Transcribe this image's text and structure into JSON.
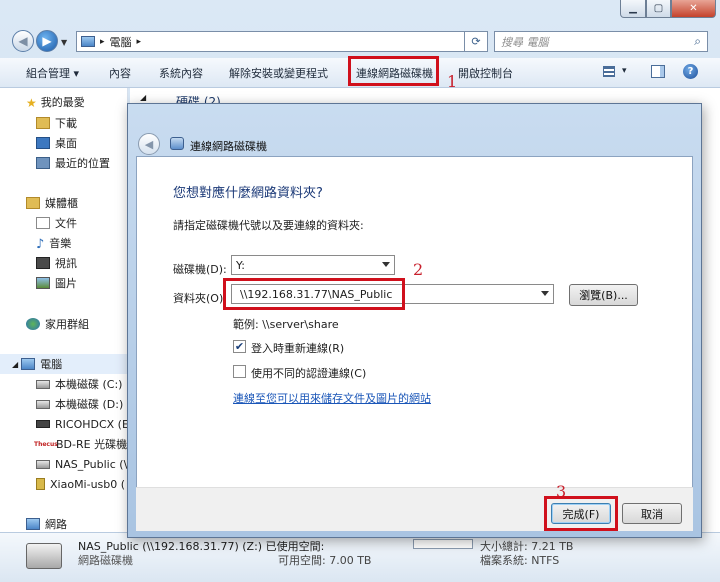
{
  "address": {
    "path": "電腦",
    "search_placeholder": "搜尋 電腦"
  },
  "toolbar": {
    "organize": "組合管理 ▾",
    "properties": "內容",
    "system_properties": "系統內容",
    "uninstall": "解除安裝或變更程式",
    "map_drive": "連線網路磁碟機",
    "control_panel": "開啟控制台",
    "view_arrow": "▾"
  },
  "annotations": {
    "n1": "1",
    "n2": "2",
    "n3": "3"
  },
  "navpane": {
    "favorites": "我的最愛",
    "fav_items": [
      "下載",
      "桌面",
      "最近的位置"
    ],
    "libraries": "媒體櫃",
    "lib_items": [
      "文件",
      "音樂",
      "視訊",
      "圖片"
    ],
    "homegroup": "家用群組",
    "computer": "電腦",
    "computer_items": [
      "本機磁碟 (C:)",
      "本機磁碟 (D:)",
      "RICOHDCX (E:",
      "BD-RE 光碟機 (",
      "NAS_Public (\\\\",
      "XiaoMi-usb0 (",
      "網路"
    ],
    "brand_label": "Thecus"
  },
  "content": {
    "group_header": "硬碟 (2)"
  },
  "status": {
    "title": "NAS_Public (\\\\192.168.31.77) (Z:) 已使用空間:",
    "type": "網路磁碟機",
    "free_label": "可用空間: 7.00 TB",
    "total_label": "大小總計: 7.21 TB",
    "fs_label": "檔案系統: NTFS"
  },
  "dialog": {
    "title": "連線網路磁碟機",
    "heading": "您想對應什麼網路資料夾?",
    "instruction": "請指定磁碟機代號以及要連線的資料夾:",
    "drive_label": "磁碟機(D):",
    "drive_value": "Y:",
    "folder_label": "資料夾(O):",
    "folder_value": "\\\\192.168.31.77\\NAS_Public",
    "browse": "瀏覽(B)...",
    "example": "範例: \\\\server\\share",
    "reconnect": "登入時重新連線(R)",
    "reconnect_checked": true,
    "diff_creds": "使用不同的認證連線(C)",
    "diff_creds_checked": false,
    "link": "連線至您可以用來儲存文件及圖片的網站",
    "finish": "完成(F)",
    "cancel": "取消"
  },
  "colors": {
    "annotation_red": "#d0101c",
    "link_blue": "#1a56b8",
    "heading_blue": "#1c3a78"
  }
}
